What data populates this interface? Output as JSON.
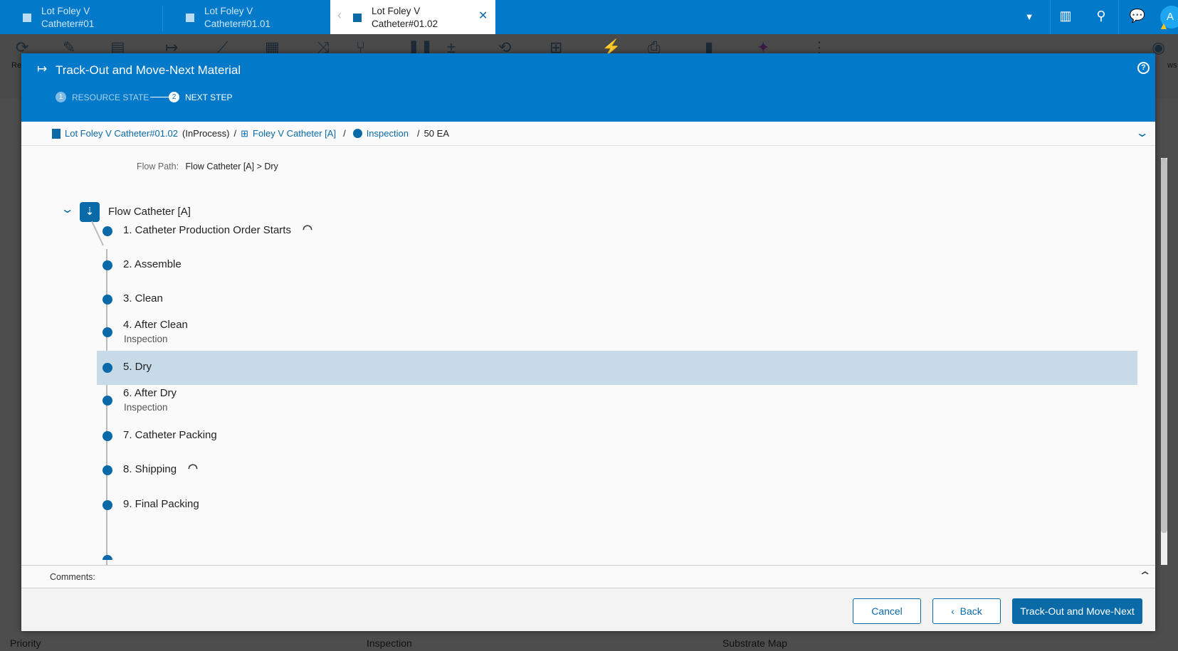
{
  "tabs": [
    {
      "line1": "Lot Foley V",
      "line2": "Catheter#01"
    },
    {
      "line1": "Lot Foley V",
      "line2": "Catheter#01.01"
    },
    {
      "line1": "Lot Foley V",
      "line2": "Catheter#01.02",
      "active": true
    }
  ],
  "topbar": {
    "avatar": "A",
    "icons": [
      "dropdown-icon",
      "barcode-icon",
      "search-icon",
      "chat-icon",
      "avatar",
      "warning-icon"
    ]
  },
  "toolbar": {
    "refresh_label_fragment": "Re",
    "views_fragment": "ws"
  },
  "dialog": {
    "title": "Track-Out and Move-Next Material",
    "steps": [
      {
        "num": "1",
        "label": "RESOURCE STATE"
      },
      {
        "num": "2",
        "label": "NEXT STEP"
      }
    ],
    "breadcrumb": {
      "lot": "Lot Foley V Catheter#01.02",
      "state": "(InProcess)",
      "flow": "Foley V Catheter [A]",
      "step": "Inspection",
      "qty": "50 EA",
      "sep": "/"
    },
    "flow_path_label": "Flow Path:",
    "flow_path_value": "Flow Catheter [A] > Dry",
    "flow_name": "Flow Catheter [A]",
    "items": [
      {
        "label": "1. Catheter Production Order Starts",
        "icon": true
      },
      {
        "label": "2. Assemble"
      },
      {
        "label": "3. Clean"
      },
      {
        "label": "4. After Clean",
        "sub": "Inspection"
      },
      {
        "label": "5. Dry",
        "selected": true
      },
      {
        "label": "6. After Dry",
        "sub": "Inspection"
      },
      {
        "label": "7. Catheter Packing"
      },
      {
        "label": "8. Shipping",
        "icon": true
      },
      {
        "label": "9. Final Packing"
      }
    ],
    "comments_label": "Comments:",
    "buttons": {
      "cancel": "Cancel",
      "back": "Back",
      "primary": "Track-Out and Move-Next"
    }
  },
  "background_labels": [
    "Priority",
    "Inspection",
    "Substrate Map"
  ],
  "colors": {
    "accent": "#0279c9",
    "primary": "#0a6aa8",
    "selected": "#c6dbe7"
  }
}
